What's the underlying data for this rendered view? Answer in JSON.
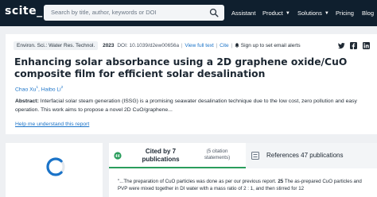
{
  "nav": {
    "logo": "scite_",
    "search_placeholder": "Search by title, author, keywords or DOI",
    "links": {
      "assistant": "Assistant",
      "product": "Product",
      "solutions": "Solutions",
      "pricing": "Pricing",
      "blog": "Blog"
    }
  },
  "article": {
    "journal": "Environ. Sci.: Water Res. Technol.",
    "year": "2023",
    "doi": "DOI: 10.1039/d2ew00656a",
    "view_full_text": "View full text",
    "cite": "Cite",
    "alert": "Sign up to set email alerts",
    "title": "Enhancing solar absorbance using a 2D graphene oxide/CuO composite film for efficient solar desalination",
    "authors": [
      {
        "name": "Chao Xu",
        "sup": "1"
      },
      {
        "name": "Haibo Li",
        "sup": "2"
      }
    ],
    "abstract_label": "Abstract:",
    "abstract_text": " Interfacial solar steam generation (ISSG) is a promising seawater desalination technique due to the low cost, zero pollution and easy operation. This work aims to propose a novel 2D CuO/graphene...",
    "understand_link": "Help me understand this report"
  },
  "tabs": {
    "cited_by": "Cited by 7 publications",
    "cited_sub": "(5 citation statements)",
    "references": "References 47 publications"
  },
  "citation": {
    "text_before": "\"...The preparation of CuO particles was done as per our previous report.",
    "ref_num": "25",
    "text_after": "The as-prepared CuO particles and PVP were mixed together in DI water with a mass ratio of 2 : 1, and then stirred for 12"
  },
  "colors": {
    "nav_bg": "#0f1f2e",
    "link": "#1a73c8",
    "tab_accent": "#2a9d5c",
    "spinner": "#1a73c8"
  }
}
